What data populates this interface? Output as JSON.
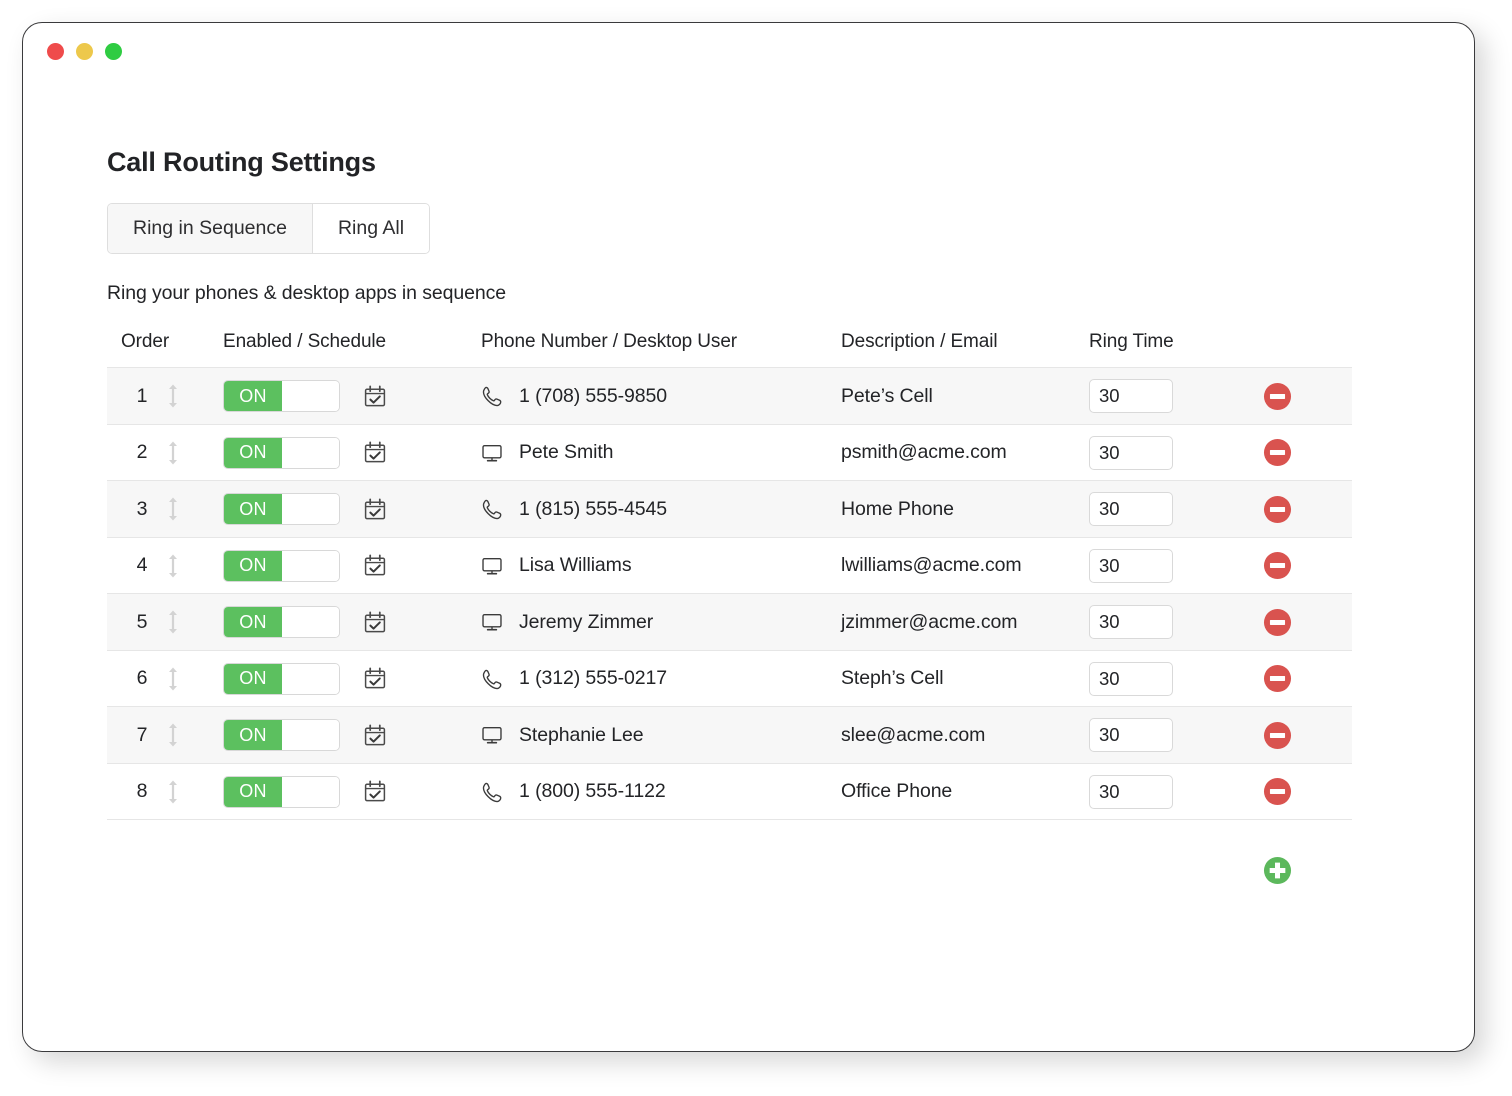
{
  "window": {
    "traffic_lights": [
      {
        "name": "close",
        "color": "#ef4b4b"
      },
      {
        "name": "minimize",
        "color": "#edc84b"
      },
      {
        "name": "maximize",
        "color": "#2fcc42"
      }
    ]
  },
  "page": {
    "title": "Call Routing Settings",
    "subtitle": "Ring your phones & desktop apps in sequence"
  },
  "tabs": [
    {
      "label": "Ring in Sequence",
      "active": true
    },
    {
      "label": "Ring All",
      "active": false
    }
  ],
  "table": {
    "headers": {
      "order": "Order",
      "enabled": "Enabled / Schedule",
      "phone": "Phone Number / Desktop User",
      "description": "Description / Email",
      "ring_time": "Ring Time"
    },
    "rows": [
      {
        "order": "1",
        "enabled": true,
        "toggle_label": "ON",
        "type": "phone",
        "target": "1 (708) 555-9850",
        "description": "Pete’s Cell",
        "ring_time": "30"
      },
      {
        "order": "2",
        "enabled": true,
        "toggle_label": "ON",
        "type": "desktop",
        "target": "Pete Smith",
        "description": "psmith@acme.com",
        "ring_time": "30"
      },
      {
        "order": "3",
        "enabled": true,
        "toggle_label": "ON",
        "type": "phone",
        "target": "1 (815) 555-4545",
        "description": "Home Phone",
        "ring_time": "30"
      },
      {
        "order": "4",
        "enabled": true,
        "toggle_label": "ON",
        "type": "desktop",
        "target": "Lisa Williams",
        "description": "lwilliams@acme.com",
        "ring_time": "30"
      },
      {
        "order": "5",
        "enabled": true,
        "toggle_label": "ON",
        "type": "desktop",
        "target": "Jeremy Zimmer",
        "description": "jzimmer@acme.com",
        "ring_time": "30"
      },
      {
        "order": "6",
        "enabled": true,
        "toggle_label": "ON",
        "type": "phone",
        "target": "1 (312) 555-0217",
        "description": "Steph’s Cell",
        "ring_time": "30"
      },
      {
        "order": "7",
        "enabled": true,
        "toggle_label": "ON",
        "type": "desktop",
        "target": "Stephanie Lee",
        "description": "slee@acme.com",
        "ring_time": "30"
      },
      {
        "order": "8",
        "enabled": true,
        "toggle_label": "ON",
        "type": "phone",
        "target": "1 (800) 555-1122",
        "description": "Office Phone",
        "ring_time": "30"
      }
    ]
  },
  "icons": {
    "drag": "drag-handle-icon",
    "schedule": "calendar-check-icon",
    "phone": "phone-icon",
    "desktop": "desktop-monitor-icon",
    "remove": "remove-circle-icon",
    "add": "add-circle-icon"
  },
  "colors": {
    "toggle_on": "#5cc05f",
    "remove": "#d9534f",
    "add": "#5cb85c",
    "row_stripe": "#f7f7f7",
    "text": "#232427"
  }
}
